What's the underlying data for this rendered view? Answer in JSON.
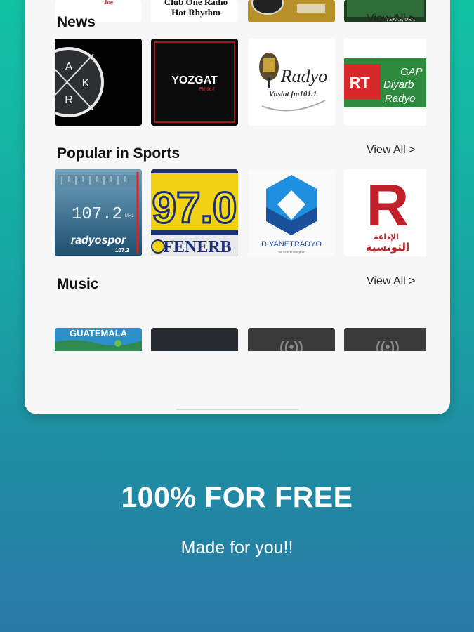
{
  "sections": {
    "top_row": {
      "stations": [
        {
          "name": "station-top-1",
          "text": "Joe"
        },
        {
          "name": "station-top-2",
          "line1": "Club One Radio",
          "line2": "Hot Rhythm"
        },
        {
          "name": "station-top-3"
        },
        {
          "name": "station-top-4",
          "text": "TEXAS, USA"
        }
      ]
    },
    "news": {
      "title": "News",
      "view_all": "View All >",
      "stations": [
        {
          "letters": [
            "A",
            "K",
            "R"
          ]
        },
        {
          "text": "YOZGAT",
          "sub": "FM 96.7"
        },
        {
          "text": "Radyo",
          "sub": "Vuslat fm101.1"
        },
        {
          "text": "RT",
          "line1": "GAP",
          "line2": "Diyarb",
          "line3": "Radyo"
        }
      ]
    },
    "sports": {
      "title": "Popular in Sports",
      "view_all": "View All >",
      "stations": [
        {
          "freq": "107.2",
          "unit": "MHz",
          "brand": "radyospor",
          "brand_num": "107.2"
        },
        {
          "text": "97.0",
          "sub": "FENERB"
        },
        {
          "text": "DİYANETRADYO",
          "tagline": "\"hür ile sesi dinleyiniz\""
        },
        {
          "text": "R",
          "arabic1": "الإذاعة",
          "arabic2": "التونسية"
        }
      ]
    },
    "music": {
      "title": "Music",
      "view_all": "View All >",
      "stations": [
        {
          "text": "GUATEMALA"
        },
        {},
        {
          "text": "((•))"
        },
        {
          "text": "((•))"
        }
      ]
    }
  },
  "footer": {
    "headline": "100% FOR FREE",
    "subline": "Made for you!!"
  },
  "colors": {
    "bg_top": "#12c2a3",
    "bg_bottom": "#2a78a6",
    "card": "#f7f7f7"
  }
}
